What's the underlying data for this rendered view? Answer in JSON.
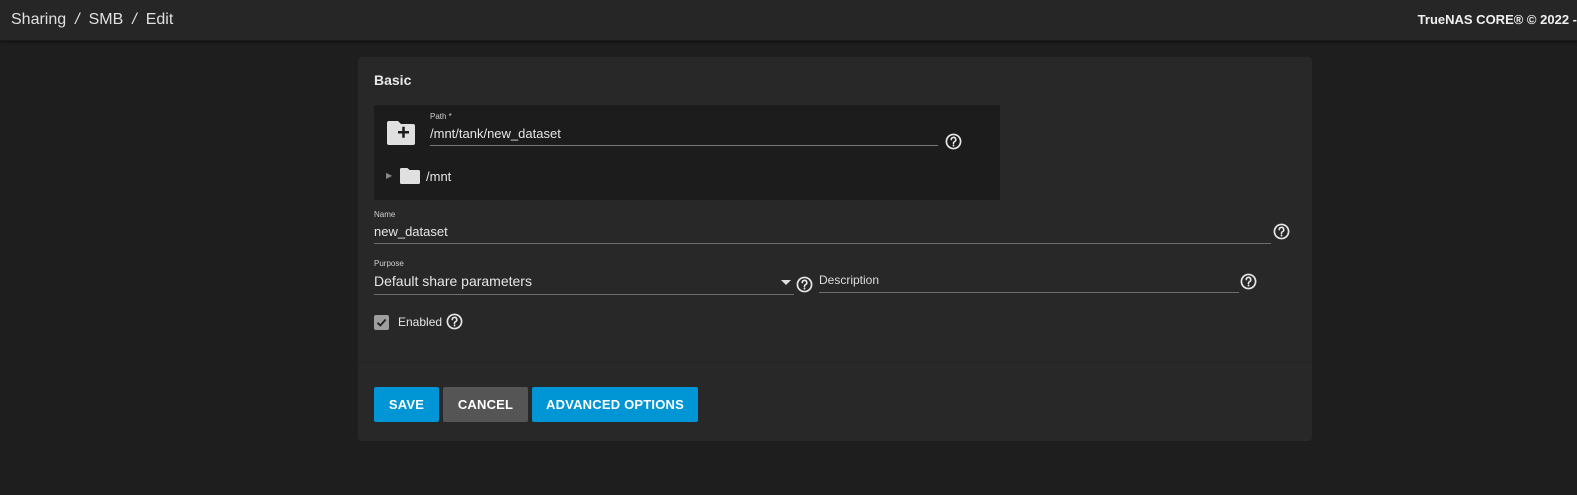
{
  "topbar": {
    "breadcrumbs": [
      "Sharing",
      "SMB",
      "Edit"
    ],
    "separator": "/",
    "brand": "TrueNAS CORE® © 2022 -"
  },
  "card": {
    "title": "Basic",
    "path": {
      "label": "Path *",
      "value": "/mnt/tank/new_dataset",
      "tree_root": "/mnt"
    },
    "name": {
      "label": "Name",
      "value": "new_dataset"
    },
    "purpose": {
      "label": "Purpose",
      "value": "Default share parameters"
    },
    "description": {
      "placeholder": "Description",
      "value": ""
    },
    "enabled": {
      "label": "Enabled",
      "checked": true
    },
    "buttons": {
      "save": "SAVE",
      "cancel": "CANCEL",
      "advanced": "ADVANCED OPTIONS"
    }
  },
  "colors": {
    "primary": "#0095d5",
    "cancel": "#555555",
    "background": "#1e1e1e",
    "card": "#282828"
  }
}
